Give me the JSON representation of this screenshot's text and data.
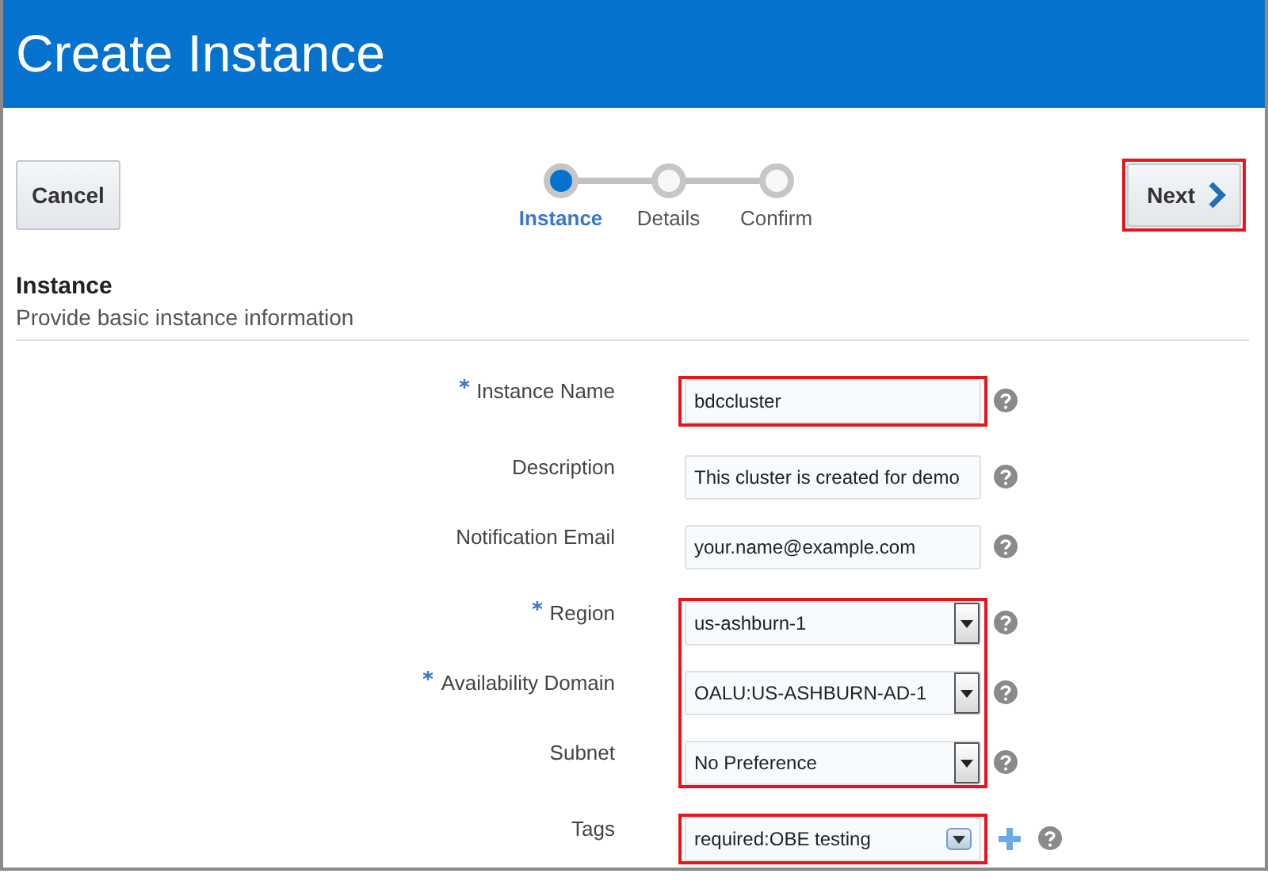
{
  "window": {
    "title": "Create Instance"
  },
  "toolbar": {
    "cancel": "Cancel",
    "next": {
      "label": "Next",
      "highlighted": true
    }
  },
  "steps": [
    {
      "label": "Instance",
      "selected": true
    },
    {
      "label": "Details",
      "selected": false
    },
    {
      "label": "Confirm",
      "selected": false
    }
  ],
  "section": {
    "title": "Instance",
    "subtitle": "Provide basic instance information"
  },
  "field_groups": [
    {
      "highlighted": true,
      "fields": [
        {
          "kind": "text",
          "label": "Instance Name",
          "required": true,
          "value": "bdccluster"
        }
      ]
    },
    {
      "highlighted": false,
      "fields": [
        {
          "kind": "text",
          "label": "Description",
          "required": false,
          "value": "This cluster is created for demo"
        },
        {
          "kind": "text",
          "label": "Notification Email",
          "required": false,
          "value": "your.name@example.com"
        }
      ]
    },
    {
      "highlighted": true,
      "fields": [
        {
          "kind": "select",
          "label": "Region",
          "required": true,
          "value": "us-ashburn-1"
        },
        {
          "kind": "select",
          "label": "Availability Domain",
          "required": true,
          "value": "OALU:US-ASHBURN-AD-1"
        },
        {
          "kind": "select",
          "label": "Subnet",
          "required": false,
          "value": "No Preference"
        }
      ]
    },
    {
      "highlighted": true,
      "fields": [
        {
          "kind": "tags",
          "label": "Tags",
          "required": false,
          "value": "required:OBE testing"
        }
      ]
    }
  ]
}
